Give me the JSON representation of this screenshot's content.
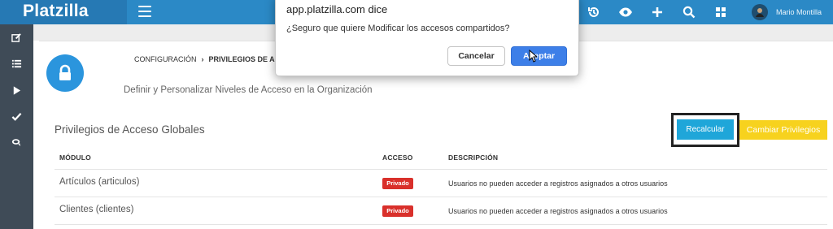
{
  "app": {
    "brand": "Platzilla",
    "user_name": "Mario Montilla"
  },
  "topbar": {
    "icons": [
      "history-icon",
      "eye-icon",
      "plus-icon",
      "search-icon",
      "grid-icon"
    ]
  },
  "sidebar": {
    "icons": [
      "edit-icon",
      "list-icon",
      "play-icon",
      "check-icon",
      "chat-icon"
    ]
  },
  "breadcrumb": {
    "parent": "CONFIGURACIÓN",
    "separator": "›",
    "current": "PRIVILEGIOS DE ACCE"
  },
  "page": {
    "subtitle": "Definir y Personalizar Niveles de Acceso en la Organización"
  },
  "section": {
    "title": "Privilegios de Acceso Globales",
    "recalc_label": "Recalcular",
    "change_label": "Cambiar Privilegios"
  },
  "table": {
    "headers": [
      "MÓDULO",
      "ACCESO",
      "DESCRIPCIÓN"
    ],
    "rows": [
      {
        "module": "Artículos (articulos)",
        "access": "Privado",
        "description": "Usuarios no pueden acceder a registros asignados a otros usuarios"
      },
      {
        "module": "Clientes (clientes)",
        "access": "Privado",
        "description": "Usuarios no pueden acceder a registros asignados a otros usuarios"
      }
    ]
  },
  "dialog": {
    "title": "app.platzilla.com dice",
    "message": "¿Seguro que quiere Modificar los accesos compartidos?",
    "cancel_label": "Cancelar",
    "accept_label": "Aceptar"
  },
  "colors": {
    "topbar": "#2b89c6",
    "brand_bg": "#2679b4",
    "sidebar": "#3f4b57",
    "accent_blue": "#1fa6d9",
    "accent_yellow": "#f7d21e",
    "badge_red": "#d9302b"
  }
}
